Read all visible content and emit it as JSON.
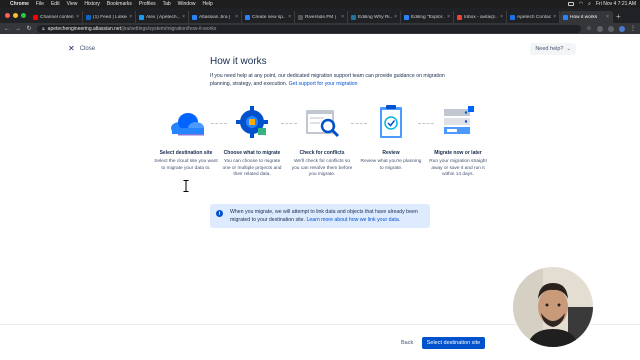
{
  "mac_menubar": {
    "app": "Chrome",
    "menus": [
      "File",
      "Edit",
      "View",
      "History",
      "Bookmarks",
      "Profiles",
      "Tab",
      "Window",
      "Help"
    ],
    "clock": "Fri Nov 4  7:21 AM"
  },
  "tabs": [
    {
      "label": "Channel content",
      "color": "#ff0000",
      "active": false
    },
    {
      "label": "(1) Feed | Linked",
      "color": "#0a66c2",
      "active": false
    },
    {
      "label": "Alex | Apetech...",
      "color": "#1d9bf0",
      "active": false
    },
    {
      "label": "Atlassian Jira |",
      "color": "#2684ff",
      "active": false
    },
    {
      "label": "Create new sp...",
      "color": "#2684ff",
      "active": false
    },
    {
      "label": "Riverside.FM |",
      "color": "#555555",
      "active": false
    },
    {
      "label": "Editing Why Ri...",
      "color": "#21759b",
      "active": false
    },
    {
      "label": "Editing \"Explor...",
      "color": "#2684ff",
      "active": false
    },
    {
      "label": "Inbox - avita@...",
      "color": "#ea4335",
      "active": false
    },
    {
      "label": "Apetech Contact",
      "color": "#1a73e8",
      "active": false
    },
    {
      "label": "How it works",
      "color": "#2684ff",
      "active": true
    }
  ],
  "address_bar": {
    "host": "apetechengineering.atlassian.net",
    "path": "/jira/settings/system/migration/how-it-works"
  },
  "page": {
    "close_label": "Close",
    "help_label": "Need help?",
    "title": "How it works",
    "intro_text": "If you need help at any point, our dedicated migration support team can provide guidance on migration planning, strategy, and execution.",
    "intro_link": "Get support for your migration",
    "steps": [
      {
        "title": "Select destination site",
        "desc": "Select the cloud site you want to migrate your data to.",
        "icon": "cloud-icon"
      },
      {
        "title": "Choose what to migrate",
        "desc": "You can choose to migrate one or multiple projects and their related data.",
        "icon": "gear-puzzle-icon"
      },
      {
        "title": "Check for conflicts",
        "desc": "We'll check for conflicts so you can resolve them before you migrate.",
        "icon": "magnifier-screen-icon"
      },
      {
        "title": "Review",
        "desc": "Review what you're planning to migrate.",
        "icon": "clipboard-check-icon"
      },
      {
        "title": "Migrate now or later",
        "desc": "Run your migration straight away or save it and run it within 14 days.",
        "icon": "server-stack-icon"
      }
    ],
    "info_text": "When you migrate, we will attempt to link data and objects that have already been migrated to your destination site.",
    "info_link": "Learn more about how we link your data.",
    "back_label": "Back",
    "primary_label": "Select destination site"
  },
  "colors": {
    "brand_blue": "#0052cc",
    "info_bg": "#deebff",
    "text_dark": "#172b4d"
  }
}
